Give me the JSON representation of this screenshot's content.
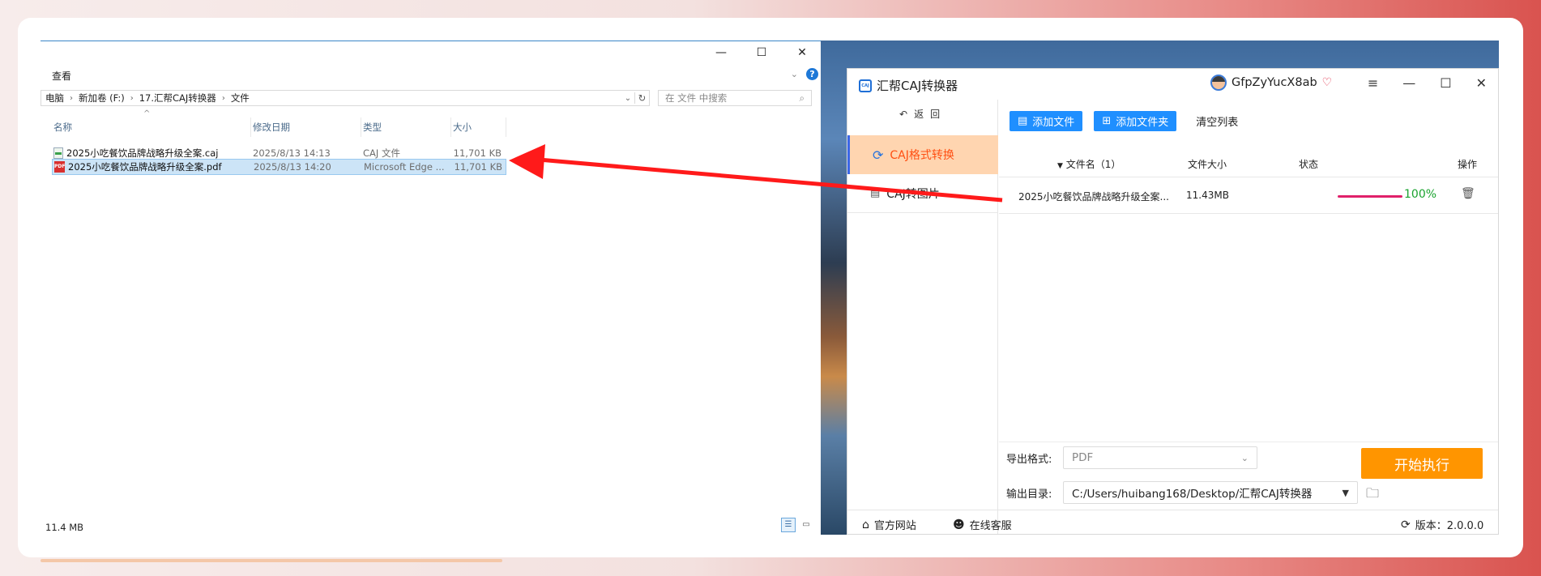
{
  "explorer": {
    "window_controls": [
      "—",
      "☐",
      "✕"
    ],
    "menu_view": "查看",
    "breadcrumb": [
      "电脑",
      "新加卷 (F:)",
      "17.汇帮CAJ转换器",
      "文件"
    ],
    "search_placeholder": "在 文件 中搜索",
    "columns": [
      "名称",
      "修改日期",
      "类型",
      "大小"
    ],
    "files": [
      {
        "name": "2025小吃餐饮品牌战略升级全案.caj",
        "date": "2025/8/13 14:13",
        "type": "CAJ 文件",
        "size": "11,701 KB",
        "icon": "caj-file-icon"
      },
      {
        "name": "2025小吃餐饮品牌战略升级全案.pdf",
        "date": "2025/8/13 14:20",
        "type": "Microsoft Edge ...",
        "size": "11,701 KB",
        "icon": "pdf-file-icon",
        "selected": true
      }
    ],
    "status_size": "11.4 MB"
  },
  "app": {
    "title": "汇帮CAJ转换器",
    "logo_text": "CAJ",
    "username": "GfpZyYucX8ab",
    "back_label": "返回",
    "sidebar": [
      {
        "label": "CAJ格式转换",
        "active": true,
        "icon": "refresh-icon"
      },
      {
        "label": "CAJ转图片",
        "active": false,
        "icon": "image-doc-icon"
      }
    ],
    "toolbar": {
      "add_file": "添加文件",
      "add_folder": "添加文件夹",
      "clear_list": "清空列表"
    },
    "table": {
      "headers": {
        "filename": "文件名（1）",
        "size": "文件大小",
        "status": "状态",
        "action": "操作"
      },
      "rows": [
        {
          "filename": "2025小吃餐饮品牌战略升级全案...",
          "size": "11.43MB",
          "progress": "100%",
          "progress_value": 1.0
        }
      ]
    },
    "export_format_label": "导出格式:",
    "export_format_value": "PDF",
    "output_dir_label": "输出目录:",
    "output_dir_value": "C:/Users/huibang168/Desktop/汇帮CAJ转换器",
    "start_button": "开始执行",
    "footer": {
      "website": "官方网站",
      "support": "在线客服",
      "version": "版本：2.0.0.0"
    }
  },
  "colors": {
    "accent_blue": "#1f8fff",
    "start_orange": "#ff9500",
    "active_side_bg": "#ffd5b0",
    "progress_pink": "#e0206a",
    "progress_text_green": "#1aa32f",
    "arrow_red": "#ff1a1a"
  }
}
